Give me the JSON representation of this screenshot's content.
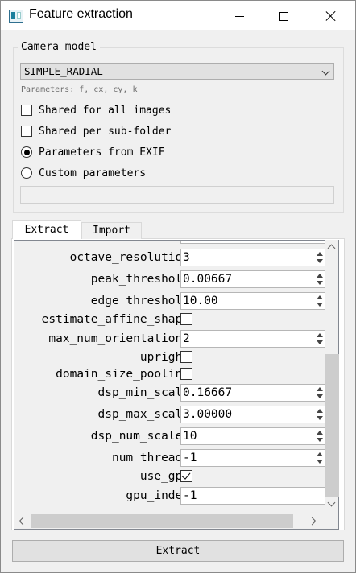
{
  "window": {
    "title": "Feature extraction",
    "icon": "app-icon",
    "controls": [
      "minimize-icon",
      "maximize-icon",
      "close-icon"
    ]
  },
  "camera_model": {
    "group_title": "Camera model",
    "selected_model": "SIMPLE_RADIAL",
    "parameters_text": "Parameters: f, cx, cy, k",
    "options": {
      "shared_all": {
        "label": "Shared for all images",
        "checked": false
      },
      "shared_subfolder": {
        "label": "Shared per sub-folder",
        "checked": false
      },
      "exif": {
        "label": "Parameters from EXIF",
        "selected": true
      },
      "custom": {
        "label": "Custom parameters",
        "selected": false
      }
    },
    "custom_params_value": ""
  },
  "tabs": [
    {
      "label": "Extract",
      "active": true
    },
    {
      "label": "Import",
      "active": false
    }
  ],
  "extract_options": [
    {
      "label": "octave_resolution",
      "type": "spin",
      "value": "3"
    },
    {
      "label": "peak_threshold",
      "type": "spin",
      "value": "0.00667"
    },
    {
      "label": "edge_threshold",
      "type": "spin",
      "value": "10.00"
    },
    {
      "label": "estimate_affine_shape",
      "type": "checkbox",
      "checked": false
    },
    {
      "label": "max_num_orientations",
      "type": "spin",
      "value": "2"
    },
    {
      "label": "upright",
      "type": "checkbox",
      "checked": false
    },
    {
      "label": "domain_size_pooling",
      "type": "checkbox",
      "checked": false
    },
    {
      "label": "dsp_min_scale",
      "type": "spin",
      "value": "0.16667"
    },
    {
      "label": "dsp_max_scale",
      "type": "spin",
      "value": "3.00000"
    },
    {
      "label": "dsp_num_scales",
      "type": "spin",
      "value": "10"
    },
    {
      "label": "num_threads",
      "type": "spin",
      "value": "-1"
    },
    {
      "label": "use_gpu",
      "type": "checkbox",
      "checked": true
    },
    {
      "label": "gpu_index",
      "type": "text",
      "value": "-1"
    }
  ],
  "extract_button": "Extract"
}
